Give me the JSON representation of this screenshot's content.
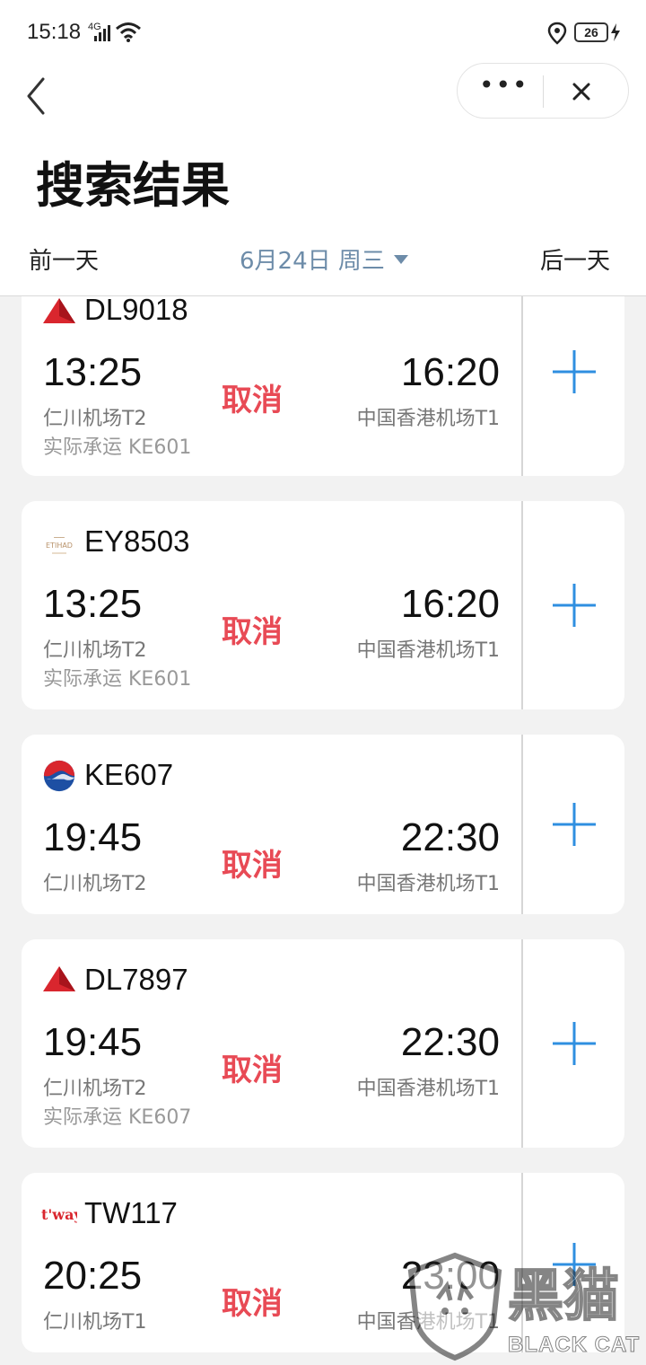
{
  "status_bar": {
    "time": "15:18",
    "network": "4G",
    "battery": "26"
  },
  "header": {
    "title": "搜索结果",
    "more_label": "•••",
    "prev_day": "前一天",
    "next_day": "后一天",
    "date": "6月24日 周三"
  },
  "flights": [
    {
      "airline": "delta",
      "flight_no": "DL9018",
      "dep_time": "13:25",
      "arr_time": "16:20",
      "status": "取消",
      "dep_airport": "仁川机场T2",
      "arr_airport": "中国香港机场T1",
      "operated_by": "实际承运 KE601"
    },
    {
      "airline": "etihad",
      "flight_no": "EY8503",
      "dep_time": "13:25",
      "arr_time": "16:20",
      "status": "取消",
      "dep_airport": "仁川机场T2",
      "arr_airport": "中国香港机场T1",
      "operated_by": "实际承运 KE601"
    },
    {
      "airline": "korean-air",
      "flight_no": "KE607",
      "dep_time": "19:45",
      "arr_time": "22:30",
      "status": "取消",
      "dep_airport": "仁川机场T2",
      "arr_airport": "中国香港机场T1",
      "operated_by": ""
    },
    {
      "airline": "delta",
      "flight_no": "DL7897",
      "dep_time": "19:45",
      "arr_time": "22:30",
      "status": "取消",
      "dep_airport": "仁川机场T2",
      "arr_airport": "中国香港机场T1",
      "operated_by": "实际承运 KE607"
    },
    {
      "airline": "tway",
      "flight_no": "TW117",
      "dep_time": "20:25",
      "arr_time": "23:00",
      "status": "取消",
      "dep_airport": "仁川机场T1",
      "arr_airport": "中国香港机场T1",
      "operated_by": ""
    }
  ],
  "logos": {
    "etihad_text": "ETIHAD",
    "tway_text": "t'way"
  },
  "watermark": {
    "text": "黑猫",
    "sub": "BLACK CAT"
  },
  "colors": {
    "accent": "#2f8fe0",
    "status_cancel": "#e84a55",
    "date_blue": "#6d8ca9",
    "delta_red": "#d9262e"
  }
}
